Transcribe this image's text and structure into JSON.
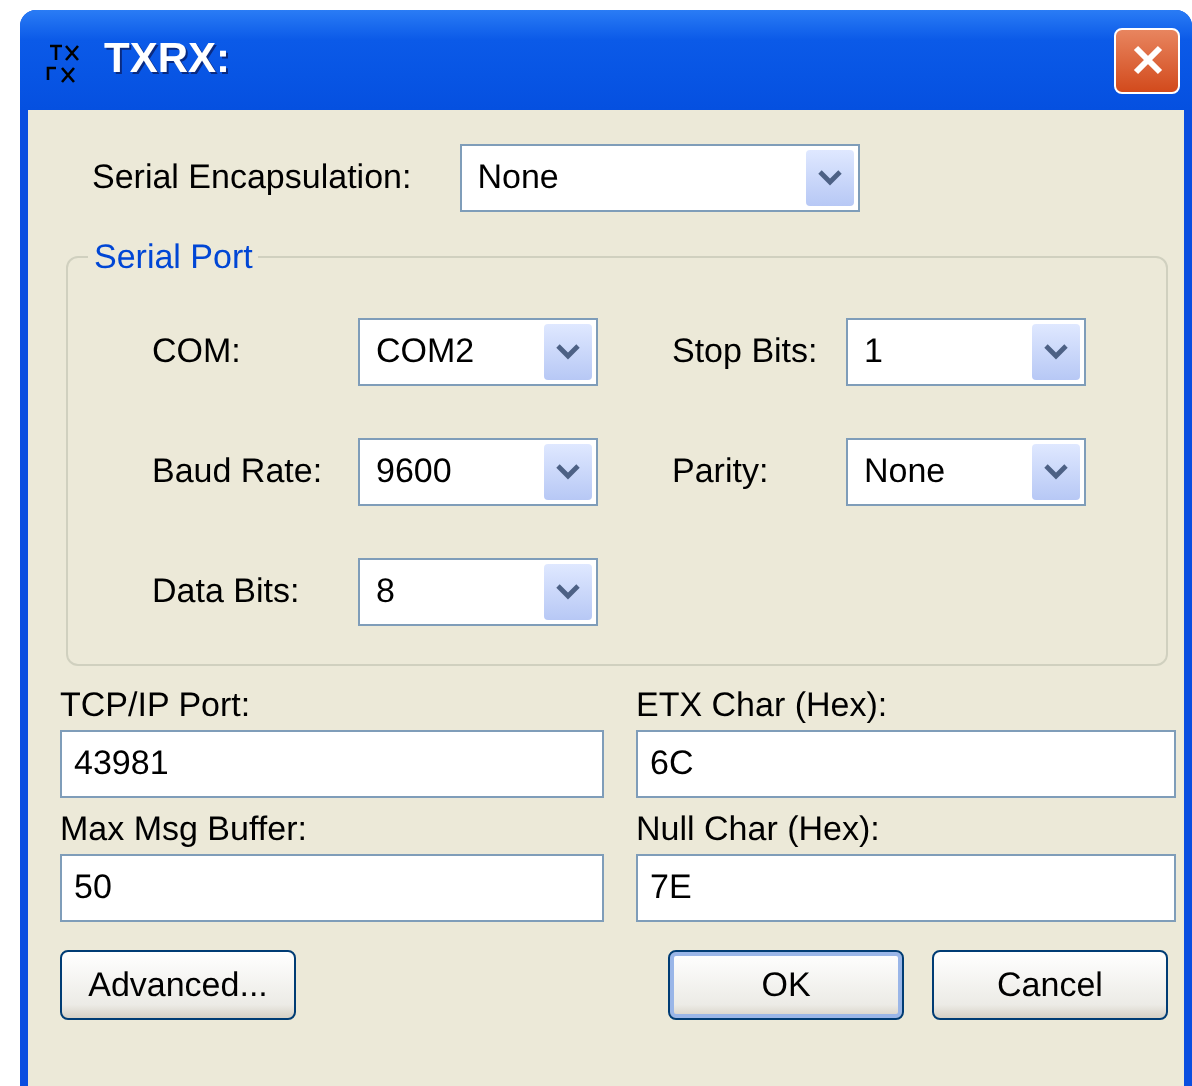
{
  "window": {
    "title": "TXRX:"
  },
  "serial_encapsulation": {
    "label": "Serial Encapsulation:",
    "value": "None"
  },
  "serial_port": {
    "title": "Serial Port",
    "fields": [
      {
        "label": "COM:",
        "value": "COM2"
      },
      {
        "label": "Stop Bits:",
        "value": "1"
      },
      {
        "label": "Baud Rate:",
        "value": "9600"
      },
      {
        "label": "Parity:",
        "value": "None"
      },
      {
        "label": "Data Bits:",
        "value": "8"
      }
    ]
  },
  "fields": [
    {
      "label": "TCP/IP Port:",
      "value": "43981"
    },
    {
      "label": "ETX Char (Hex):",
      "value": "6C"
    },
    {
      "label": "Max Msg Buffer:",
      "value": "50"
    },
    {
      "label": "Null Char (Hex):",
      "value": "7E"
    }
  ],
  "buttons": [
    {
      "label": "Advanced...",
      "default": false
    },
    {
      "label": "OK",
      "default": true
    },
    {
      "label": "Cancel",
      "default": false
    }
  ]
}
